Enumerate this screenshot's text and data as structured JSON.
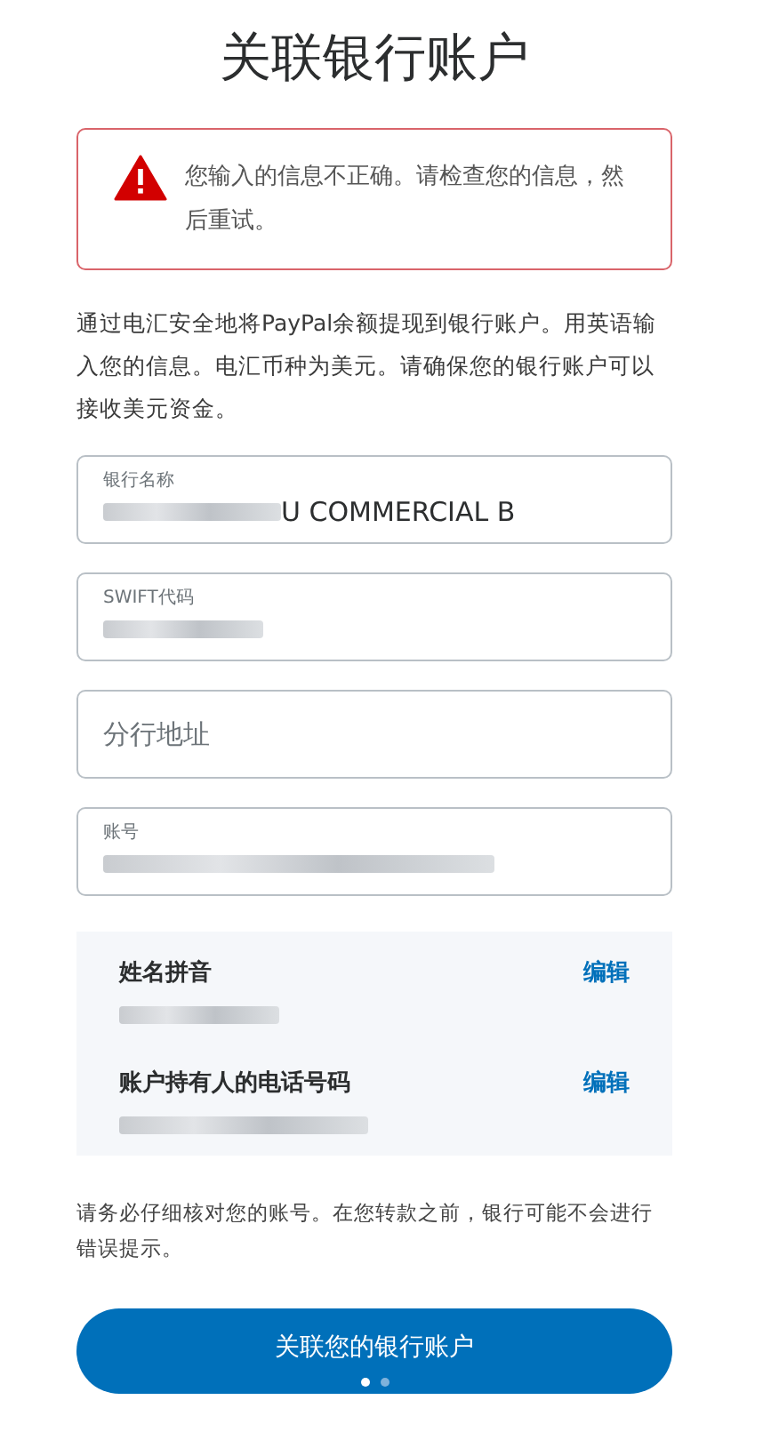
{
  "title": "关联银行账户",
  "alert": {
    "message": "您输入的信息不正确。请检查您的信息，然后重试。"
  },
  "intro": "通过电汇安全地将PayPal余额提现到银行账户。用英语输入您的信息。电汇币种为美元。请确保您的银行账户可以接收美元资金。",
  "fields": [
    {
      "label": "银行名称",
      "value": "U COMMERCIAL B",
      "redacted": true
    },
    {
      "label": "SWIFT代码",
      "redacted": true
    },
    {
      "placeholder": "分行地址"
    },
    {
      "label": "账号",
      "redacted": true
    }
  ],
  "details": [
    {
      "label": "姓名拼音",
      "action": "编辑",
      "redacted": true
    },
    {
      "label": "账户持有人的电话号码",
      "action": "编辑",
      "redacted": true
    }
  ],
  "note": "请务必仔细核对您的账号。在您转款之前，银行可能不会进行错误提示。",
  "submit": "关联您的银行账户",
  "pager": [
    {
      "selected": true
    },
    {
      "selected": false
    }
  ]
}
